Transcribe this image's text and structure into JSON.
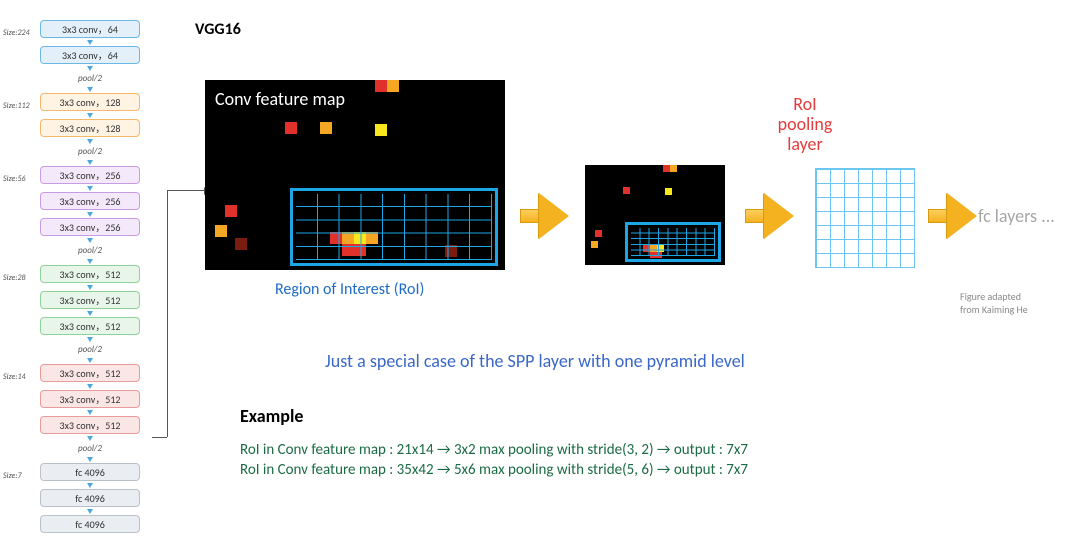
{
  "title": "VGG16",
  "vgg": {
    "groups": [
      {
        "size": "Size:224",
        "color": "c-blue",
        "blocks": [
          "3x3 conv，64",
          "3x3 conv，64"
        ],
        "pool": "pool/2"
      },
      {
        "size": "Size:112",
        "color": "c-orange",
        "blocks": [
          "3x3 conv，128",
          "3x3 conv，128"
        ],
        "pool": "pool/2"
      },
      {
        "size": "Size:56",
        "color": "c-purple",
        "blocks": [
          "3x3 conv，256",
          "3x3 conv，256",
          "3x3 conv，256"
        ],
        "pool": "pool/2"
      },
      {
        "size": "Size:28",
        "color": "c-green",
        "blocks": [
          "3x3 conv，512",
          "3x3 conv，512",
          "3x3 conv，512"
        ],
        "pool": "pool/2"
      },
      {
        "size": "Size:14",
        "color": "c-red",
        "blocks": [
          "3x3 conv，512",
          "3x3 conv，512",
          "3x3 conv，512"
        ],
        "pool": "pool/2"
      },
      {
        "size": "Size:7",
        "color": "c-gray",
        "blocks": [
          "fc 4096",
          "fc 4096",
          "fc 4096"
        ],
        "pool": null
      }
    ]
  },
  "fm_caption": "Conv feature map",
  "roi_caption": "Region of Interest (RoI)",
  "roi_pool_label_l1": "RoI",
  "roi_pool_label_l2": "pooling",
  "roi_pool_label_l3": "layer",
  "fc_label": "fc layers ...",
  "credit_l1": "Figure adapted",
  "credit_l2": "from Kaiming He",
  "spp_line": "Just a special case of the SPP layer with one pyramid level",
  "example_heading": "Example",
  "example_l1": "RoI in Conv feature map : 21x14 → 3x2 max pooling with stride(3, 2) → output : 7x7",
  "example_l2": "RoI in Conv feature map : 35x42 → 5x6 max pooling with stride(5, 6) → output : 7x7",
  "chart_data": {
    "type": "diagram",
    "backbone": "VGG16",
    "roi_pool_output": [
      7,
      7
    ],
    "examples": [
      {
        "roi_size": [
          21,
          14
        ],
        "pool_window": [
          3,
          2
        ],
        "stride": [
          3,
          2
        ],
        "output": [
          7,
          7
        ]
      },
      {
        "roi_size": [
          35,
          42
        ],
        "pool_window": [
          5,
          6
        ],
        "stride": [
          5,
          6
        ],
        "output": [
          7,
          7
        ]
      }
    ],
    "layers": [
      {
        "spatial": 224,
        "ops": [
          "conv3x3-64",
          "conv3x3-64"
        ],
        "downsample": "pool/2"
      },
      {
        "spatial": 112,
        "ops": [
          "conv3x3-128",
          "conv3x3-128"
        ],
        "downsample": "pool/2"
      },
      {
        "spatial": 56,
        "ops": [
          "conv3x3-256",
          "conv3x3-256",
          "conv3x3-256"
        ],
        "downsample": "pool/2"
      },
      {
        "spatial": 28,
        "ops": [
          "conv3x3-512",
          "conv3x3-512",
          "conv3x3-512"
        ],
        "downsample": "pool/2"
      },
      {
        "spatial": 14,
        "ops": [
          "conv3x3-512",
          "conv3x3-512",
          "conv3x3-512"
        ],
        "downsample": "pool/2"
      },
      {
        "spatial": 7,
        "ops": [
          "fc-4096",
          "fc-4096",
          "fc-4096"
        ],
        "downsample": null
      }
    ]
  }
}
